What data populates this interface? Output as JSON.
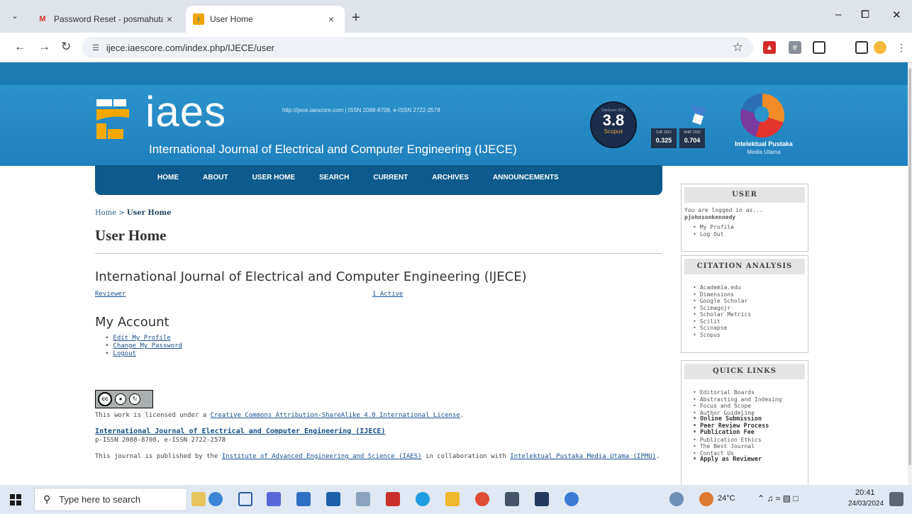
{
  "browser": {
    "tabs": [
      {
        "title": "Password Reset - posmahutaso",
        "close": "×"
      },
      {
        "title": "User Home",
        "close": "×"
      }
    ],
    "new_tab": "+",
    "url": "ijece.iaescore.com/index.php/IJECE/user",
    "window_controls": [
      "–",
      "⧠",
      "✕"
    ]
  },
  "header": {
    "logo_text": "iaes",
    "journal_name": "International Journal of Electrical and Computer Engineering (IJECE)",
    "meta": "http://ijece.iaescore.com  |  ISSN 2088-8708, e-ISSN 2722-2578",
    "citescore": {
      "label": "CiteScore 2022",
      "value": "3.8",
      "sub": "Scopus"
    },
    "metrics": [
      {
        "label": "SJR 2022",
        "value": "0.325"
      },
      {
        "label": "SNIP 2022",
        "value": "0.704"
      }
    ],
    "publisher": {
      "name": "Intelektual Pustaka",
      "sub": "Media Utama"
    }
  },
  "nav": [
    "HOME",
    "ABOUT",
    "USER HOME",
    "SEARCH",
    "CURRENT",
    "ARCHIVES",
    "ANNOUNCEMENTS"
  ],
  "breadcrumb": {
    "home": "Home",
    "sep": " > ",
    "current": "User Home"
  },
  "page_title": "User Home",
  "journal_heading": "International Journal of Electrical and Computer Engineering (IJECE)",
  "role": {
    "name": "Reviewer",
    "active": "1 Active"
  },
  "account": {
    "heading": "My Account",
    "links": [
      "Edit My Profile",
      "Change My Password",
      "Logout"
    ]
  },
  "footer": {
    "cc_text": "cc",
    "cc_sub": "BY  SA",
    "license_prefix": "This work is licensed under a ",
    "license_link": "Creative Commons Attribution-ShareAlike 4.0 International License",
    "license_suffix": ".",
    "journal_title": "International Journal of Electrical and Computer Engineering (IJECE)",
    "issn": "p-ISSN 2088-8708, e-ISSN 2722-2578",
    "published_prefix": "This journal is published by the ",
    "iaes_link": "Institute of Advanced Engineering and Science (IAES)",
    "published_mid": " in collaboration with ",
    "ipmu_link": "Intelektual Pustaka Media Utama (IPMU)",
    "published_suffix": "."
  },
  "sidebar": {
    "user": {
      "title": "USER",
      "logged_in_as": "You are logged in as...",
      "username": "pjohnsonkennedy",
      "links": [
        "My Profile",
        "Log Out"
      ]
    },
    "citation": {
      "title": "CITATION ANALYSIS",
      "links": [
        "Academia.edu",
        "Dimensions",
        "Google Scholar",
        "Scimagojr",
        "Scholar Metrics",
        "Scilit",
        "Scinapse",
        "Scopus"
      ]
    },
    "quick_links": {
      "title": "QUICK LINKS",
      "links": [
        {
          "label": "Editorial Boards",
          "bold": false
        },
        {
          "label": "Abstracting and Indexing",
          "bold": false
        },
        {
          "label": "Focus and Scope",
          "bold": false
        },
        {
          "label": "Author Guideline",
          "bold": false
        },
        {
          "label": "Online Submission",
          "bold": true
        },
        {
          "label": "Peer Review Process",
          "bold": true
        },
        {
          "label": "Publication Fee",
          "bold": true
        },
        {
          "label": "Publication Ethics",
          "bold": false
        },
        {
          "label": "The Best Journal",
          "bold": false
        },
        {
          "label": "Contact Us",
          "bold": false
        },
        {
          "label": "Apply as Reviewer",
          "bold": true
        }
      ]
    }
  },
  "taskbar": {
    "search_placeholder": "Type here to search",
    "weather": "24°C",
    "time": "20:41",
    "date": "24/03/2024"
  }
}
